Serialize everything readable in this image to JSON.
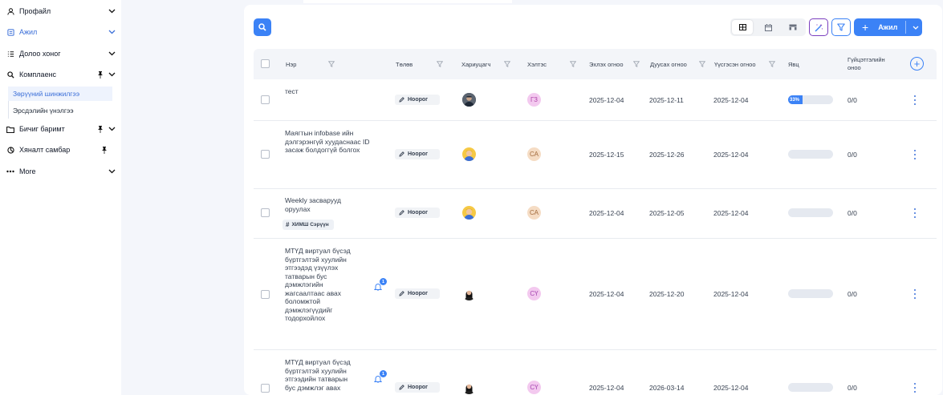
{
  "sidebar": {
    "items": [
      {
        "label": "Профайл",
        "icon": "user-icon"
      },
      {
        "label": "Ажил",
        "icon": "list-icon"
      },
      {
        "label": "Долоо хоног",
        "icon": "checklist-icon"
      },
      {
        "label": "Комплаенс",
        "icon": "search-icon"
      },
      {
        "label": "Бичиг баримт",
        "icon": "folder-icon"
      },
      {
        "label": "Хяналт самбар",
        "icon": "dashboard-icon"
      },
      {
        "label": "More",
        "icon": "more-icon"
      }
    ],
    "subitems": [
      "Зөрүүний шинжилгээ",
      "Эрсдэлийн үнэлгээ"
    ]
  },
  "toolbar": {
    "add_label": "Ажил",
    "view_icons": [
      "table-view-icon",
      "calendar-view-icon",
      "board-view-icon"
    ]
  },
  "table": {
    "headers": [
      "Нэр",
      "Төлөв",
      "Хариуцагч",
      "Хэлтэс",
      "Эхлэх огноо",
      "Дуусах огноо",
      "Үүсгэсэн огноо",
      "Явц",
      "Гүйцэтгэлийн оноо"
    ],
    "rows": [
      {
        "name": "тест",
        "status": "Ноорог",
        "avatar": "avatar-man-dark",
        "dept": "ГЗ",
        "start": "2025-12-04",
        "end": "2025-12-11",
        "created": "2025-12-04",
        "progress": 33,
        "progress_label": "33%",
        "score": "0/0"
      },
      {
        "name": "Маягтын infobase ийн дэлгэрэнгүй хуудаснаас ID засаж болдоггүй болгох",
        "status": "Ноорог",
        "avatar": "avatar-man-blond",
        "dept": "СА",
        "start": "2025-12-15",
        "end": "2025-12-26",
        "created": "2025-12-04",
        "progress": 0,
        "score": "0/0"
      },
      {
        "name": "Weekly засваруудоруулах",
        "name_display": "Weekly засварууд оруулах",
        "tag": "ХИМШ Сэрүүн",
        "status": "Ноорог",
        "avatar": "avatar-man-blond",
        "dept": "СА",
        "start": "2025-12-04",
        "end": "2025-12-05",
        "created": "2025-12-04",
        "progress": 0,
        "score": "0/0"
      },
      {
        "name": "МТҮД виртуал бүсэд бүртгэлтэй хуулийн этгээдэд үзүүлэх татварын бус дэмжлэгийн жагсаалтаас авах боломжтой дэмжлэгүүдийг тодорхойлох",
        "bell_count": "1",
        "status": "Ноорог",
        "avatar": "avatar-woman",
        "dept": "СҮ",
        "start": "2025-12-04",
        "end": "2025-12-20",
        "created": "2025-12-04",
        "progress": 0,
        "score": "0/0"
      },
      {
        "name": "МТҮД виртуал бүсэд бүртгэлтэй хуулийн этгээдийн татварын бус дэмжлэг авах",
        "bell_count": "1",
        "status": "Ноорог",
        "avatar": "avatar-woman",
        "dept": "СҮ",
        "start": "2025-12-04",
        "end": "2026-03-14",
        "created": "2025-12-04",
        "progress": 0,
        "score": "0/0"
      }
    ]
  },
  "colors": {
    "accent": "#3b82f6",
    "magic": "#7b3fbf",
    "page_bg": "#f4f6fb"
  }
}
